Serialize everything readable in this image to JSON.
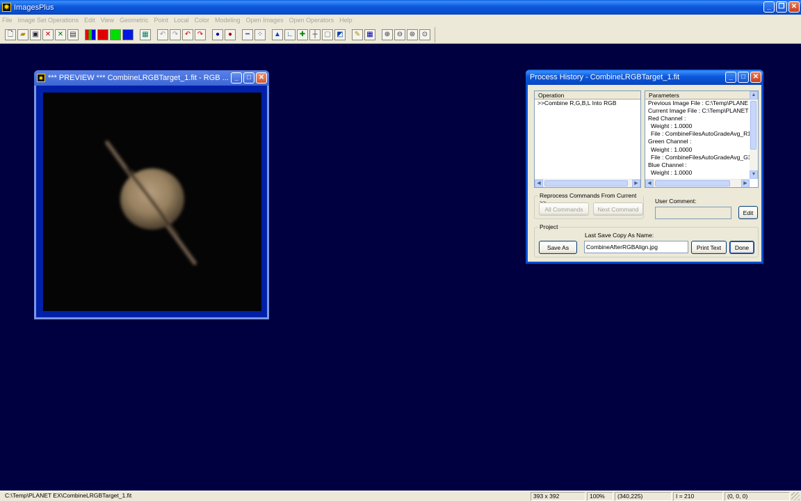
{
  "app": {
    "title": "ImagesPlus"
  },
  "menu": [
    "File",
    "Image Set Operations",
    "Edit",
    "View",
    "Geometric",
    "Point",
    "Local",
    "Color",
    "Modeling",
    "Open Images",
    "Open Operators",
    "Help"
  ],
  "preview": {
    "title": "*** PREVIEW *** CombineLRGBTarget_1.fit - RGB ..."
  },
  "process_history": {
    "title": "Process History - CombineLRGBTarget_1.fit",
    "operation_header": "Operation",
    "operations": [
      ">>Combine R,G,B,L Into RGB"
    ],
    "parameters_header": "Parameters",
    "parameters": [
      "Previous Image File : C:\\Temp\\PLANE",
      "Current Image File : C:\\Temp\\PLANET",
      "Red Channel :",
      " Weight : 1.0000",
      " File : CombineFilesAutoGradeAvg_R1",
      "Green Channel :",
      " Weight : 1.0000",
      " File : CombineFilesAutoGradeAvg_G1",
      "Blue Channel :",
      " Weight : 1.0000"
    ],
    "reprocess_label": "Reprocess Commands From Current >>",
    "all_commands": "All Commands",
    "next_command": "Next Command",
    "user_comment_label": "User Comment:",
    "user_comment_value": "",
    "edit_button": "Edit",
    "project_label": "Project",
    "save_as": "Save As",
    "last_save_label": "Last Save Copy As Name:",
    "last_save_value": "CombineAfterRGBAlign.jpg",
    "print_text": "Print Text",
    "done": "Done"
  },
  "status": {
    "path": "C:\\Temp\\PLANET EX\\CombineLRGBTarget_1.fit",
    "size": "393 x 392",
    "zoom": "100%",
    "coords": "(340,225)",
    "intensity": "I = 210",
    "rgb": "(0, 0, 0)"
  },
  "colors": {
    "workspace": "#000040",
    "title_blue": "#0a5ce6"
  }
}
